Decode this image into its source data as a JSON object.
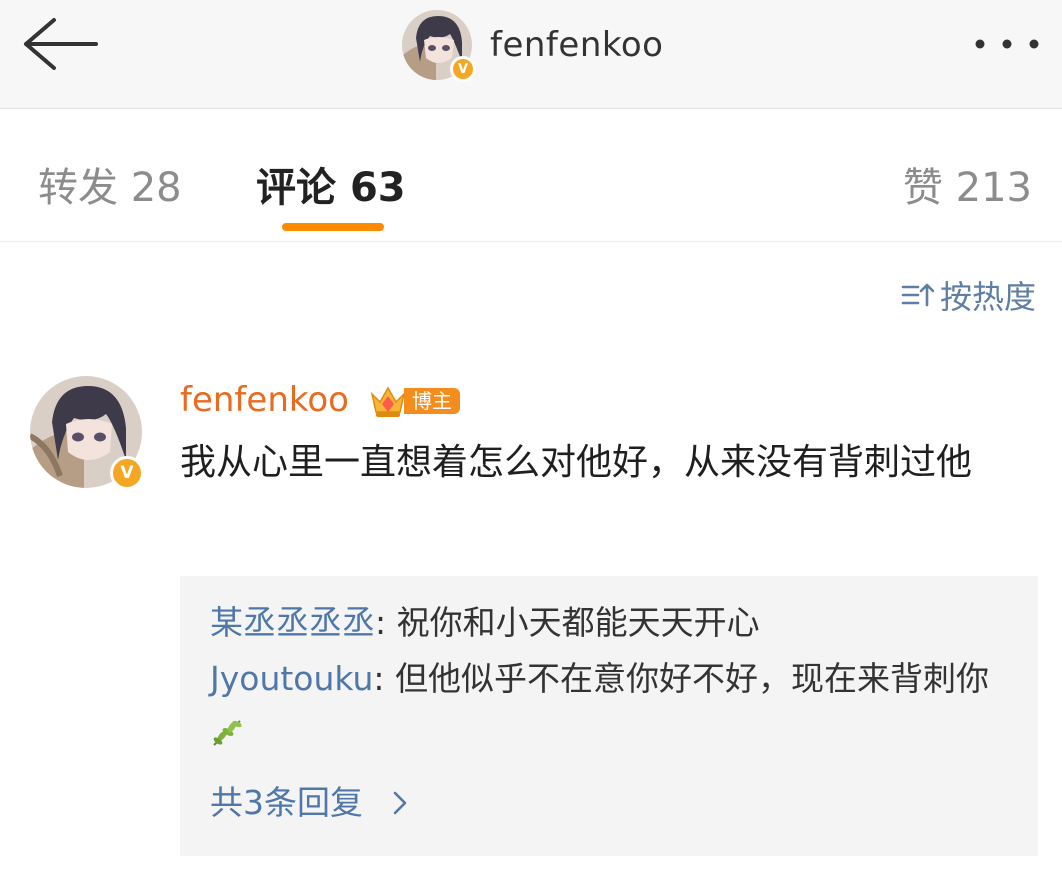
{
  "header": {
    "title": "fenfenkoo",
    "back_icon": "arrow-left-icon",
    "more_icon": "more-dots-icon",
    "verified_mark": "V"
  },
  "tabs": [
    {
      "label": "转发",
      "count": "28",
      "active": false
    },
    {
      "label": "评论",
      "count": "63",
      "active": true
    },
    {
      "label": "赞",
      "count": "213",
      "active": false
    }
  ],
  "sort": {
    "label": "按热度",
    "icon": "sort-icon"
  },
  "comment": {
    "author": "fenfenkoo",
    "badge": "博主",
    "verified_mark": "V",
    "text": "我从心里一直想着怎么对他好，从来没有背刺过他",
    "replies": [
      {
        "user": "某丞丞丞丞",
        "text": "祝你和小天都能天天开心"
      },
      {
        "user": "Jyoutouku",
        "text": "但他似乎不在意你好不好，现在来背刺你"
      }
    ],
    "more_replies": "共3条回复"
  },
  "colors": {
    "accent": "#ff8a00",
    "author": "#e86b1e",
    "link": "#4f77a8",
    "verified": "#f5a623",
    "reply_bg": "#f4f4f4"
  }
}
